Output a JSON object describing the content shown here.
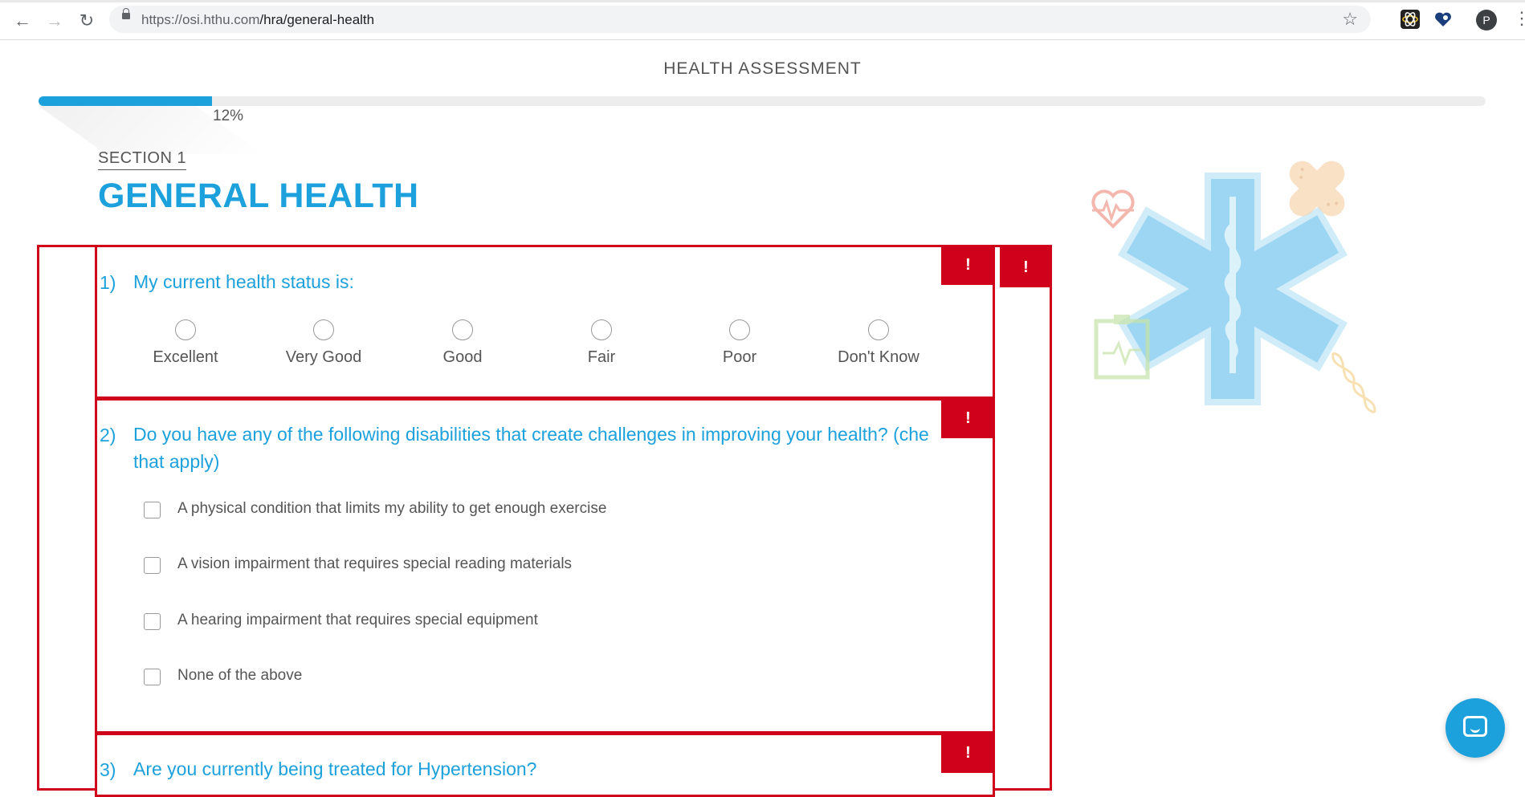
{
  "browser": {
    "url_host": "https://osi.hthu.com",
    "url_path": "/hra/general-health",
    "profile_initial": "P"
  },
  "header": {
    "title": "HEALTH ASSESSMENT"
  },
  "progress": {
    "value_percent": 12,
    "label": "12%"
  },
  "section": {
    "label": "SECTION 1",
    "title": "GENERAL HEALTH"
  },
  "alert_glyph": "!",
  "questions": [
    {
      "number": "1)",
      "text": "My current health status is:",
      "type": "radio",
      "options": [
        "Excellent",
        "Very Good",
        "Good",
        "Fair",
        "Poor",
        "Don't Know"
      ]
    },
    {
      "number": "2)",
      "text_line1": "Do you have any of the following disabilities that create challenges in improving your health? (che",
      "text_line2": "that apply)",
      "type": "checkbox",
      "options": [
        "A physical condition that limits my ability to get enough exercise",
        "A vision impairment that requires special reading materials",
        "A hearing impairment that requires special equipment",
        "None of the above"
      ]
    },
    {
      "number": "3)",
      "text": "Are you currently being treated for Hypertension?"
    }
  ],
  "colors": {
    "accent": "#1da1dc",
    "error": "#d0021b"
  },
  "icons": {
    "back": "arrow-left",
    "forward": "arrow-right",
    "reload": "reload",
    "secure": "lock",
    "bookmark": "star",
    "chat": "chat-bubble"
  }
}
